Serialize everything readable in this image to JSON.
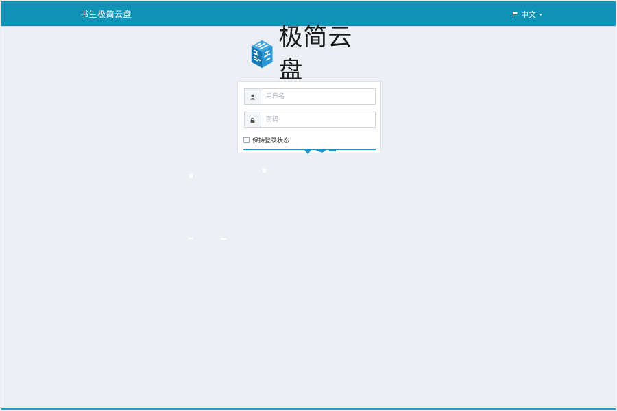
{
  "header": {
    "brand": "书生极简云盘",
    "language": {
      "label": "中文",
      "icon": "flag-icon",
      "caret": "caret-down-icon"
    }
  },
  "logo": {
    "text": "极简云盘",
    "icon": "cube-logo-icon"
  },
  "login_form": {
    "username": {
      "placeholder": "用户名",
      "value": "",
      "icon": "user-icon"
    },
    "password": {
      "placeholder": "密码",
      "value": "",
      "icon": "lock-icon"
    },
    "remember_me": {
      "label": "保持登录状态",
      "checked": false
    }
  },
  "colors": {
    "header_bg": "#0e93b7",
    "page_bg": "#eceff4",
    "accent": "#1d90c1",
    "logo_blue": "#1a88c8"
  }
}
